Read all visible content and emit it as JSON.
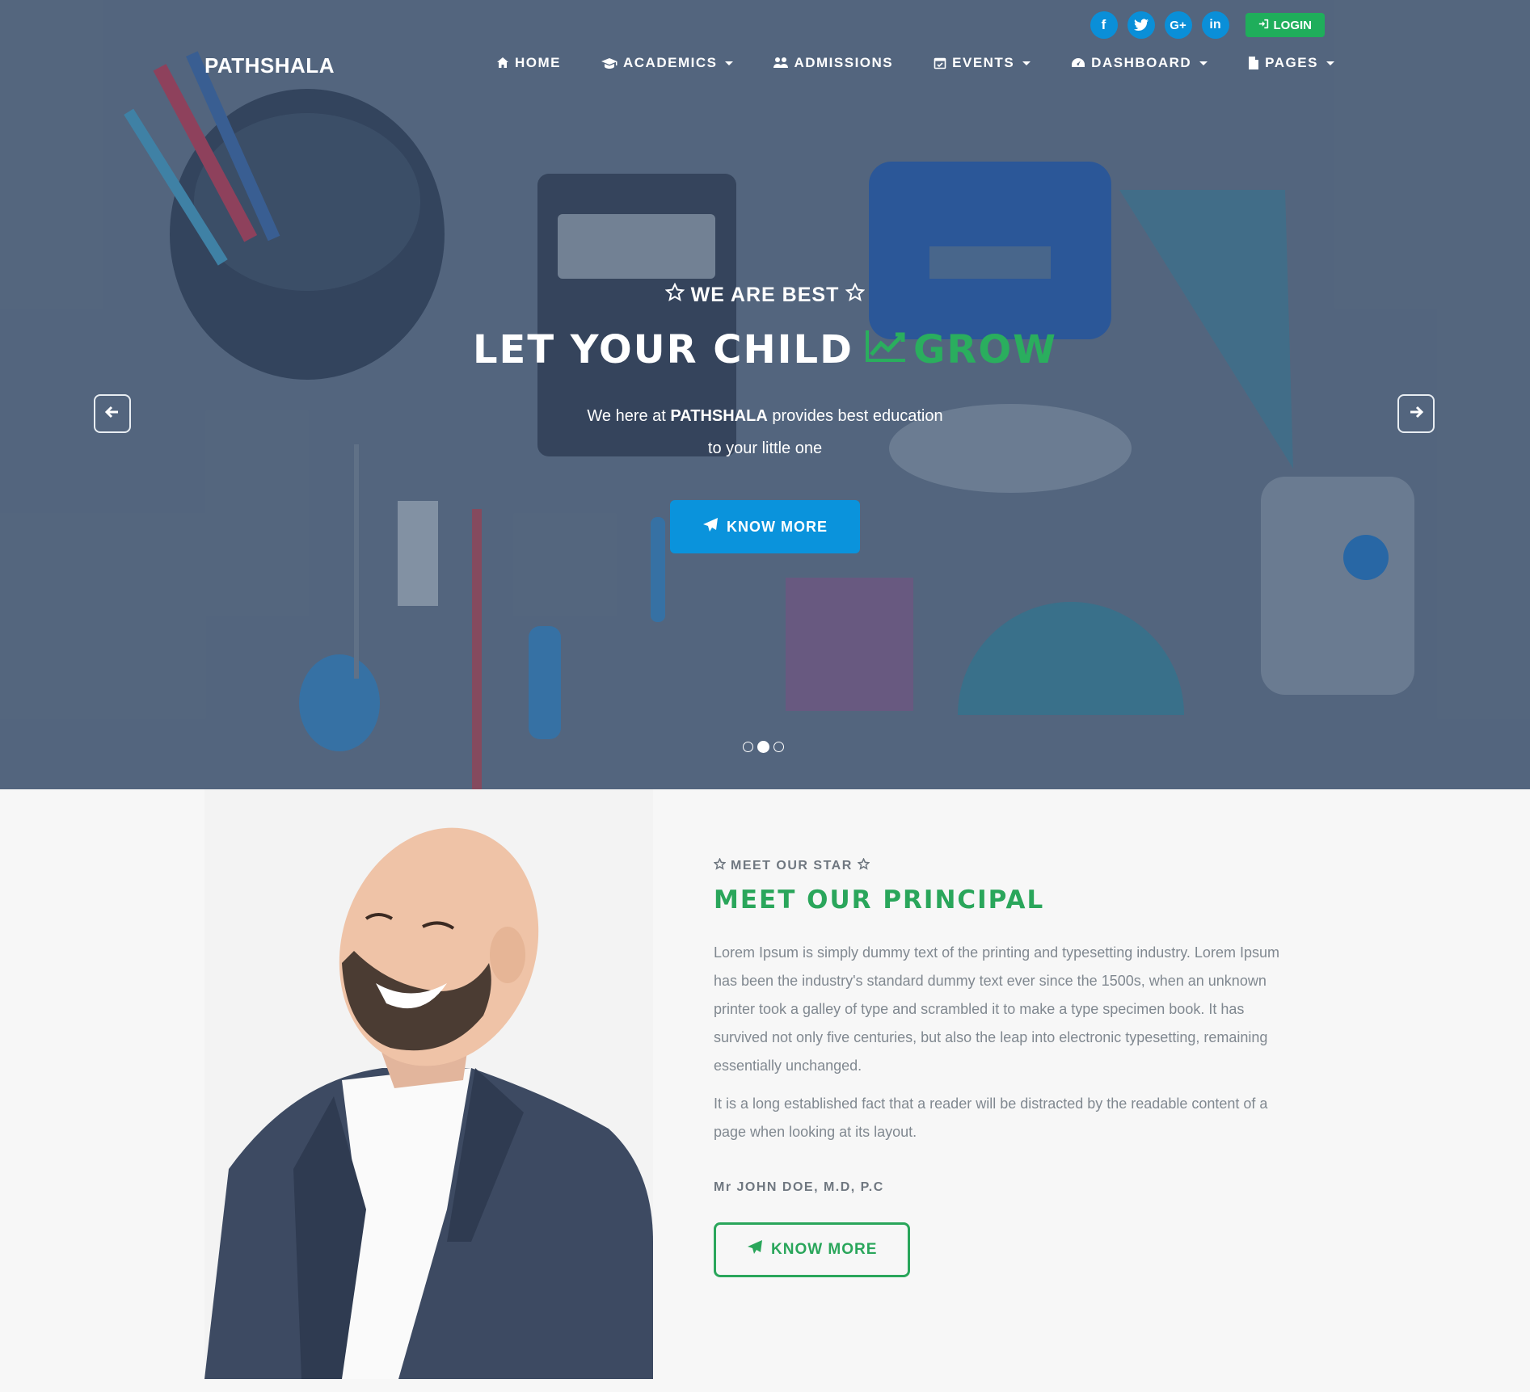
{
  "topbar": {
    "socials": [
      {
        "name": "facebook",
        "glyph": "f"
      },
      {
        "name": "twitter",
        "glyph": "t"
      },
      {
        "name": "google-plus",
        "glyph": "G+"
      },
      {
        "name": "linkedin",
        "glyph": "in"
      }
    ],
    "login_label": "LOGIN"
  },
  "brand": "PATHSHALA",
  "nav": {
    "home": "HOME",
    "academics": "ACADEMICS",
    "admissions": "ADMISSIONS",
    "events": "EVENTS",
    "dashboard": "DASHBOARD",
    "pages": "PAGES"
  },
  "hero": {
    "eyebrow": "WE ARE BEST",
    "headline_part1": "LET YOUR CHILD",
    "headline_part2": "GROW",
    "text_before": "We here at",
    "text_brand": "PATHSHALA",
    "text_after": "provides best education",
    "text_line2": "to your little one",
    "button": "KNOW MORE",
    "slides_total": 3,
    "active_slide": 2
  },
  "principal": {
    "eyebrow": "MEET OUR STAR",
    "title": "MEET OUR PRINCIPAL",
    "paragraph1": "Lorem Ipsum is simply dummy text of the printing and typesetting industry. Lorem Ipsum has been the industry's standard dummy text ever since the 1500s, when an unknown printer took a galley of type and scrambled it to make a type specimen book. It has survived not only five centuries, but also the leap into electronic typesetting, remaining essentially unchanged.",
    "paragraph2": "It is a long established fact that a reader will be distracted by the readable content of a page when looking at its layout.",
    "name": "Mr JOHN DOE, M.D, P.C",
    "button": "KNOW MORE"
  },
  "colors": {
    "accent_green": "#2aa65b",
    "accent_blue": "#0a93dc",
    "hero_overlay": "#56677f"
  }
}
